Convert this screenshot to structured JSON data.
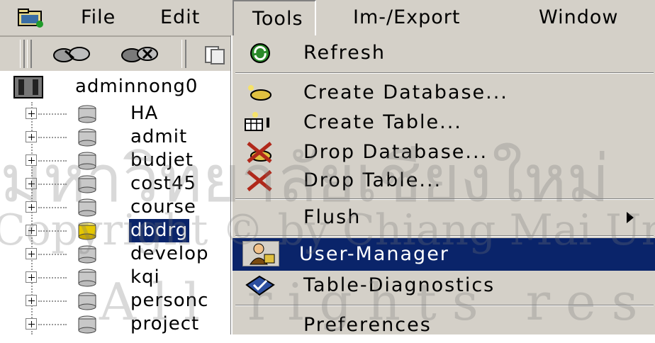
{
  "menubar": {
    "items": [
      {
        "label": "File"
      },
      {
        "label": "Edit"
      },
      {
        "label": "Tools"
      },
      {
        "label": "Im-/Export"
      },
      {
        "label": "Window"
      }
    ]
  },
  "tree": {
    "root_label": "adminnong0",
    "items": [
      {
        "label": "HA"
      },
      {
        "label": "admit"
      },
      {
        "label": "budjet"
      },
      {
        "label": "cost45"
      },
      {
        "label": "course"
      },
      {
        "label": "dbdrg"
      },
      {
        "label": "develop"
      },
      {
        "label": "kqi"
      },
      {
        "label": "personc"
      },
      {
        "label": "project"
      }
    ]
  },
  "tools_menu": {
    "items": [
      {
        "label": "Refresh",
        "icon": "refresh-icon"
      },
      {
        "label": "Create Database...",
        "icon": "create-database-icon"
      },
      {
        "label": "Create Table...",
        "icon": "create-table-icon"
      },
      {
        "label": "Drop Database...",
        "icon": "drop-database-icon"
      },
      {
        "label": "Drop Table...",
        "icon": "drop-table-icon"
      },
      {
        "label": "Flush",
        "icon": ""
      },
      {
        "label": "User-Manager",
        "icon": "user-manager-icon"
      },
      {
        "label": "Table-Diagnostics",
        "icon": "table-diagnostics-icon"
      },
      {
        "label": "Preferences",
        "icon": ""
      }
    ]
  },
  "watermark": {
    "line1": "มหาวิทยาลัยเชียงใหม่",
    "line2": "Copyright © by Chiang Mai University",
    "line3": "All rights reserved"
  },
  "colors": {
    "menu_bg": "#d4d0c8",
    "highlight": "#0a246a"
  }
}
